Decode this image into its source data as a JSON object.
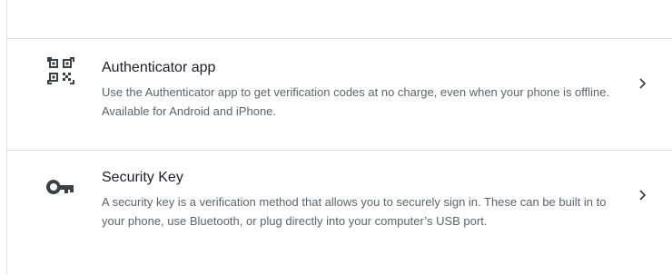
{
  "options": [
    {
      "title": "Authenticator app",
      "description": "Use the Authenticator app to get verification codes at no charge, even when your phone is offline. Available for Android and iPhone.",
      "icon": "qr-code-icon"
    },
    {
      "title": "Security Key",
      "description": "A security key is a verification method that allows you to securely sign in. These can be built in to your phone, use Bluetooth, or plug directly into your computer’s USB port.",
      "icon": "key-icon"
    }
  ],
  "colors": {
    "title": "#202124",
    "description": "#5f6368",
    "icon": "#3c4043",
    "divider": "#dadce0"
  }
}
